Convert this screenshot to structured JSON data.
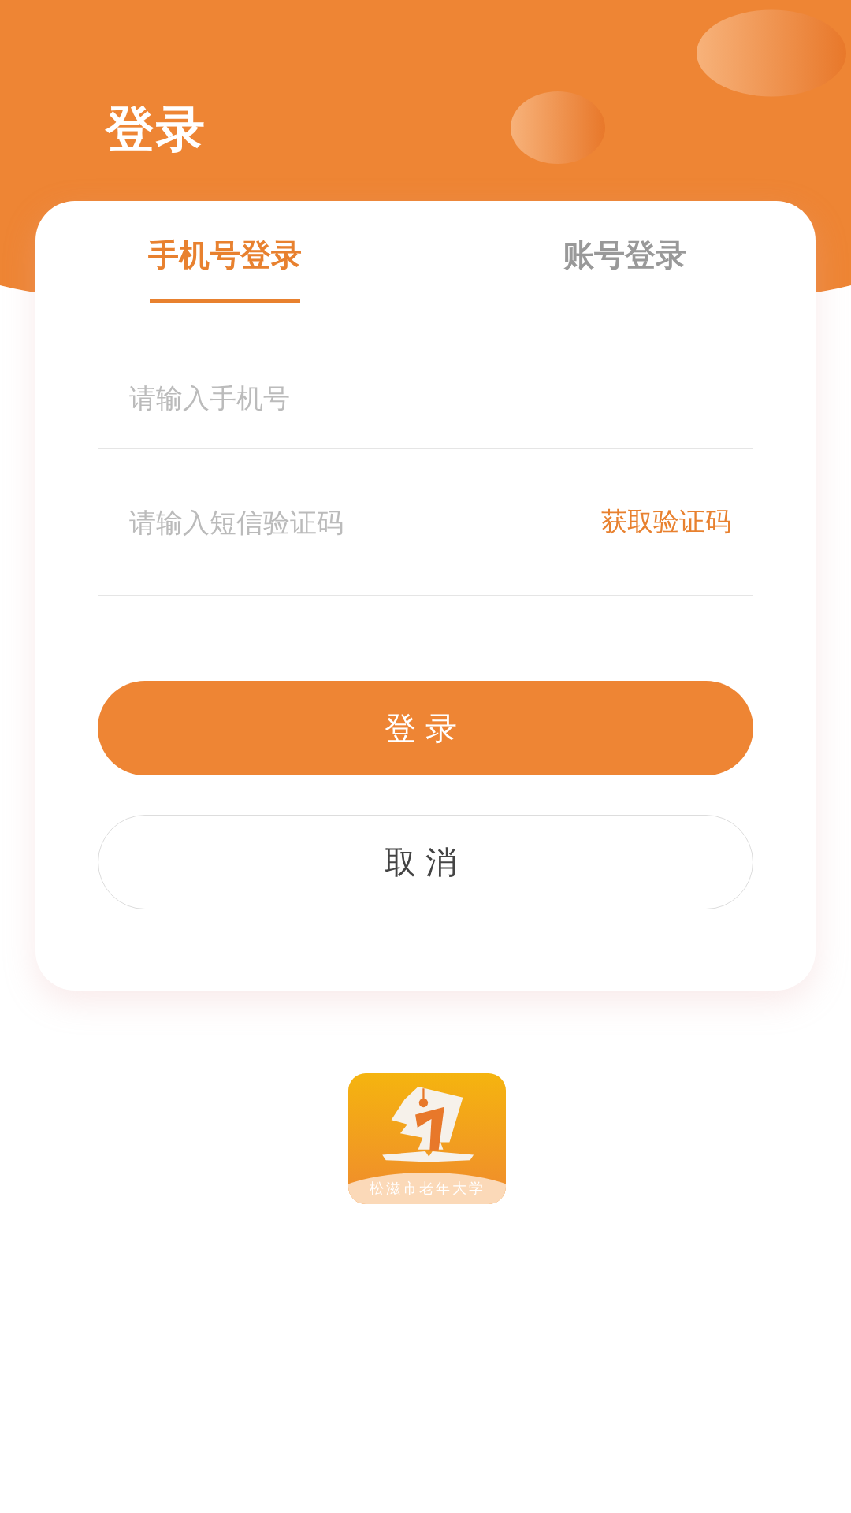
{
  "header": {
    "title": "登录"
  },
  "tabs": [
    {
      "label": "手机号登录",
      "selected": true
    },
    {
      "label": "账号登录",
      "selected": false
    }
  ],
  "fields": [
    {
      "placeholder": "请输入手机号"
    },
    {
      "placeholder": "请输入短信验证码",
      "action": "获取验证码"
    }
  ],
  "buttons": [
    {
      "label": "登录",
      "kind": "primary"
    },
    {
      "label": "取消",
      "kind": "secondary"
    }
  ],
  "logo": {
    "caption": "松滋市老年大学"
  }
}
